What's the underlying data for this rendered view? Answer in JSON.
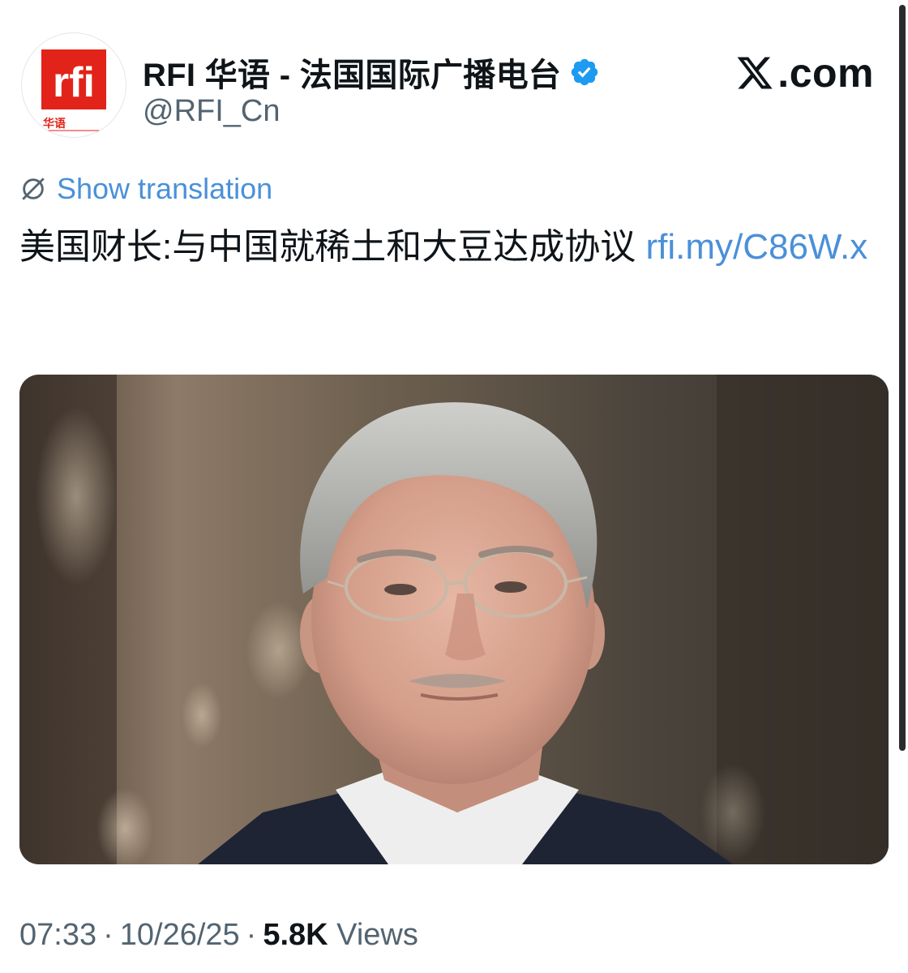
{
  "account": {
    "display_name": "RFI 华语 - 法国国际广播电台",
    "handle": "@RFI_Cn",
    "verified": true,
    "avatar_logo_text": "rfi",
    "avatar_sub_text": "华语"
  },
  "branding": {
    "site": ".com"
  },
  "translate": {
    "label": "Show translation"
  },
  "tweet": {
    "text": "美国财长:与中国就稀土和大豆达成协议 ",
    "link": "rfi.my/C86W.x"
  },
  "meta": {
    "time": "07:33",
    "date": "10/26/25",
    "views_count": "5.8K",
    "views_label": "Views",
    "separator": "·"
  },
  "colors": {
    "link": "#4a90d9",
    "verified": "#1d9bf0",
    "rfi_red": "#e2231a"
  }
}
